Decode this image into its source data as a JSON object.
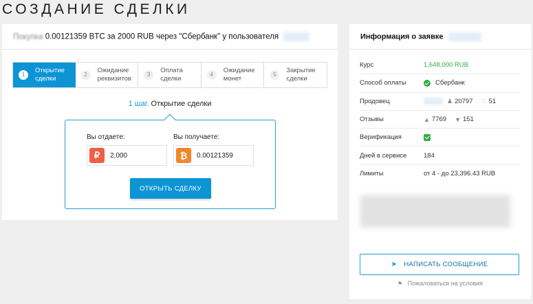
{
  "page": {
    "title": "СОЗДАНИЕ СДЕЛКИ"
  },
  "trade": {
    "header_prefix": "Покупка",
    "header_text": "0.00121359 BTC за 2000 RUB через \"Сбербанк\" у пользователя",
    "steps": [
      {
        "num": "1",
        "label_line1": "Открытие",
        "label_line2": "сделки",
        "active": true
      },
      {
        "num": "2",
        "label_line1": "Ожидание",
        "label_line2": "реквизитов",
        "active": false
      },
      {
        "num": "3",
        "label_line1": "Оплата",
        "label_line2": "сделки",
        "active": false
      },
      {
        "num": "4",
        "label_line1": "Ожидание",
        "label_line2": "монет",
        "active": false
      },
      {
        "num": "5",
        "label_line1": "Закрытие",
        "label_line2": "сделки",
        "active": false
      }
    ],
    "current_step_num": "1 шаг.",
    "current_step_text": "Открытие сделки",
    "give_label": "Вы отдаете:",
    "give_currency_icon": "₽",
    "give_value": "2,000",
    "receive_label": "Вы получаете:",
    "receive_currency_icon": "₿",
    "receive_value": "0.00121359",
    "open_button": "ОТКРЫТЬ СДЕЛКУ"
  },
  "info": {
    "title": "Информация о заявке",
    "rows": {
      "rate_label": "Курс",
      "rate_value": "1,648,000 RUB",
      "payment_label": "Способ оплаты",
      "payment_value": "Сбербанк",
      "seller_label": "Продовец",
      "seller_deals": "20797",
      "seller_rating": "51",
      "reviews_label": "Отзывы",
      "reviews_positive": "7769",
      "reviews_negative": "151",
      "verification_label": "Верификация",
      "days_label": "Дней в сервисе",
      "days_value": "184",
      "limits_label": "Лимиты",
      "limits_value": "от 4 - до 23,396.43 RUB"
    },
    "message_button": "НАПИСАТЬ СООБЩЕНИЕ",
    "complain_link": "Пожаловаться на условия"
  },
  "colors": {
    "accent": "#0d94d5",
    "green": "#2fae43",
    "rub": "#ef5f45",
    "btc": "#f0872a"
  },
  "icons": [
    "ruble-icon",
    "bitcoin-icon",
    "sberbank-icon",
    "user-icon",
    "diamond-icon",
    "thumbs-up-icon",
    "thumbs-down-icon",
    "check-icon",
    "telegram-plane-icon",
    "flag-icon"
  ]
}
